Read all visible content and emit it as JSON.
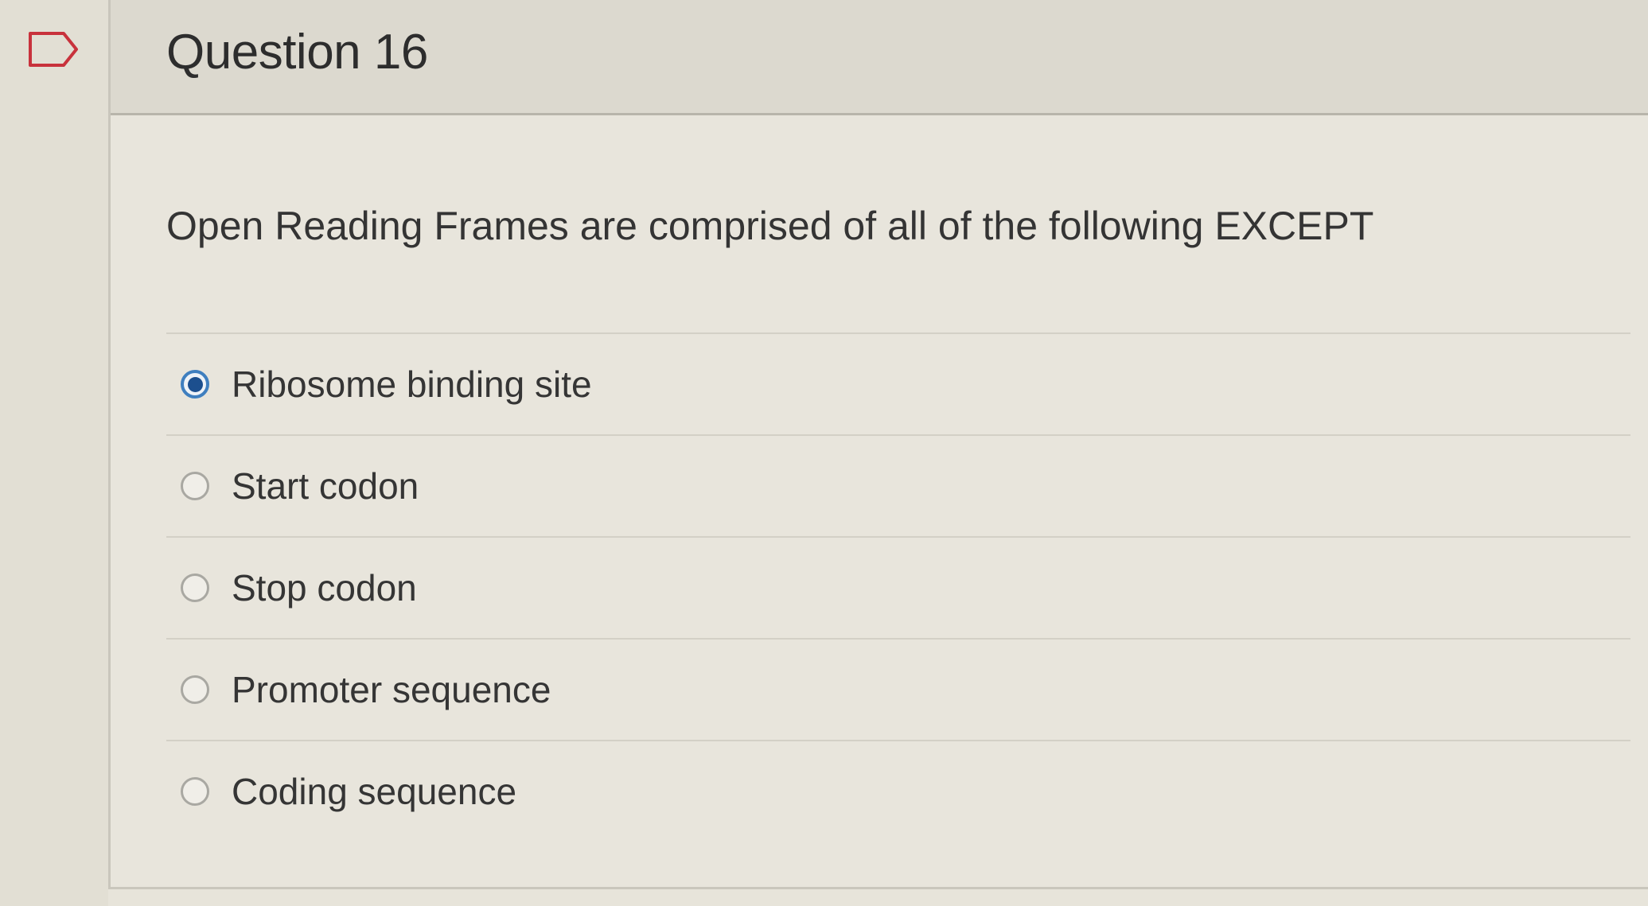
{
  "question": {
    "title": "Question 16",
    "text": "Open Reading Frames are comprised of all of the following EXCEPT"
  },
  "answers": [
    {
      "label": "Ribosome binding site",
      "selected": true
    },
    {
      "label": "Start codon",
      "selected": false
    },
    {
      "label": "Stop codon",
      "selected": false
    },
    {
      "label": "Promoter sequence",
      "selected": false
    },
    {
      "label": "Coding sequence",
      "selected": false
    }
  ],
  "icons": {
    "flag": "flag-icon",
    "radio_selected": "radio-selected-icon",
    "radio_unselected": "radio-unselected-icon"
  },
  "colors": {
    "selected_radio": "#1c4f8e",
    "selected_ring": "#3f7fbf"
  }
}
